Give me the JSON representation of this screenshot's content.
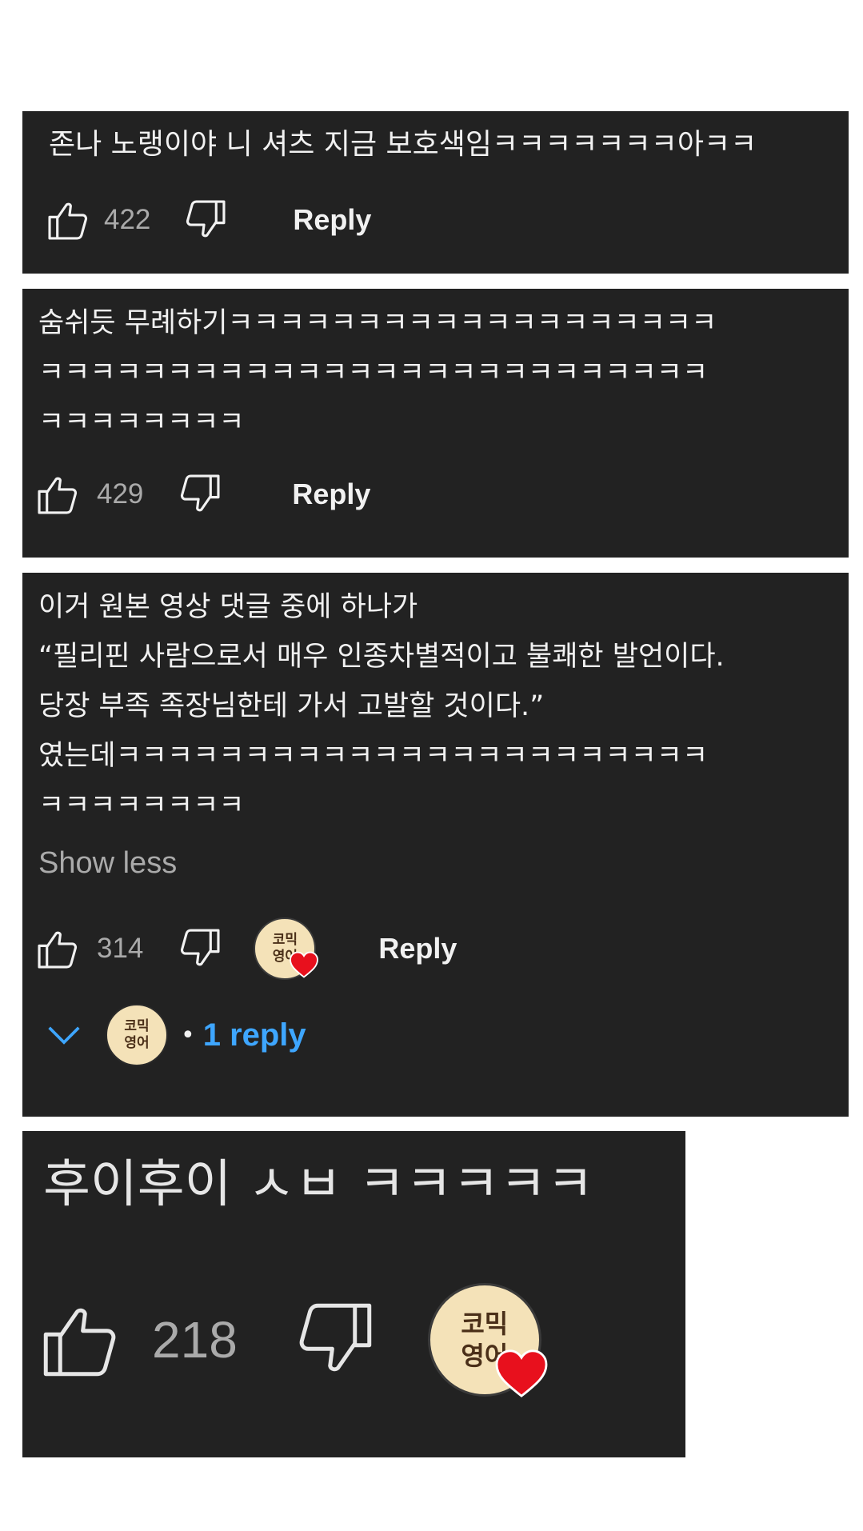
{
  "comments": [
    {
      "text": "존나 노랭이야 니 셔츠 지금 보호색임ㅋㅋㅋㅋㅋㅋㅋ아ㅋㅋ",
      "likes": "422",
      "reply_label": "Reply"
    },
    {
      "text": "숨쉬듯 무례하기ㅋㅋㅋㅋㅋㅋㅋㅋㅋㅋㅋㅋㅋㅋㅋㅋㅋㅋㅋ\nㅋㅋㅋㅋㅋㅋㅋㅋㅋㅋㅋㅋㅋㅋㅋㅋㅋㅋㅋㅋㅋㅋㅋㅋㅋㅋ\nㅋㅋㅋㅋㅋㅋㅋㅋ",
      "likes": "429",
      "reply_label": "Reply"
    },
    {
      "text": "이거 원본 영상 댓글 중에 하나가\n“필리핀 사람으로서 매우 인종차별적이고 불쾌한 발언이다.\n당장 부족 족장님한테 가서 고발할 것이다.”\n였는데ㅋㅋㅋㅋㅋㅋㅋㅋㅋㅋㅋㅋㅋㅋㅋㅋㅋㅋㅋㅋㅋㅋㅋ\nㅋㅋㅋㅋㅋㅋㅋㅋ",
      "show_less": "Show less",
      "likes": "314",
      "reply_label": "Reply",
      "creator_avatar": [
        "코믹",
        "영어"
      ],
      "replies_separator": "•",
      "replies_label": "1 reply"
    },
    {
      "text": "후이후이 ㅅㅂ ㅋㅋㅋㅋㅋ",
      "likes": "218",
      "creator_avatar": [
        "코믹",
        "영어"
      ]
    }
  ],
  "colors": {
    "card_bg": "#222222",
    "text": "#f1f1f1",
    "muted": "#aaaaaa",
    "link": "#3ea6ff",
    "heart": "#e8101d"
  },
  "icons": [
    "thumbs-up-icon",
    "thumbs-down-icon",
    "heart-icon",
    "chevron-down-icon"
  ]
}
